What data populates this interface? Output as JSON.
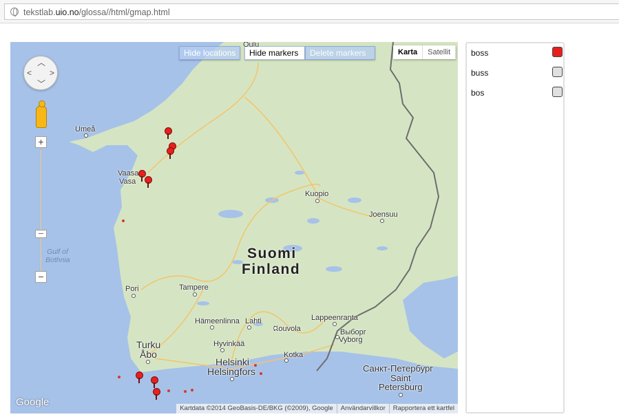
{
  "browser": {
    "url_prefix": "tekstlab.",
    "url_domain": "uio.no",
    "url_path": "/glossa//html/gmap.html"
  },
  "map": {
    "buttons": {
      "hide_locations": "Hide locations",
      "hide_markers": "Hide markers",
      "delete_markers": "Delete markers"
    },
    "map_types": [
      "Karta",
      "Satellit"
    ],
    "selected_map_type": "Karta",
    "places": {
      "umea": "Umeå",
      "oulu": "Oulu",
      "vaasa": "Vaasa",
      "vasa": "Vasa",
      "kuopio": "Kuopio",
      "joensuu": "Joensuu",
      "gulf1": "Gulf of",
      "gulf2": "Bothnia",
      "suomi": "Suomi",
      "finland": "Finland",
      "pori": "Pori",
      "tampere": "Tampere",
      "hameenlinna": "Hämeenlinna",
      "lahti": "Lahti",
      "kouvola": "Kouvola",
      "lappeenranta": "Lappeenranta",
      "vyborg_ru": "Выборг",
      "vyborg": "Vyborg",
      "kotka": "Kotka",
      "hyvinkaa": "Hyvinkää",
      "turku": "Turku",
      "abo": "Åbo",
      "helsinki": "Helsinki",
      "helsingfors": "Helsingfors",
      "spb_ru": "Санкт-Петербург",
      "spb_saint": "Saint",
      "spb": "Petersburg"
    },
    "logo": "Google",
    "attribution": [
      "Kartdata ©2014 GeoBasis-DE/BKG (©2009), Google",
      "Användarvillkor",
      "Rapportera ett kartfel"
    ]
  },
  "legend": {
    "items": [
      {
        "label": "boss",
        "color": "#e8201d",
        "checked": true
      },
      {
        "label": "buss",
        "color": "#e0e0e0",
        "checked": false
      },
      {
        "label": "bos",
        "color": "#e0e0e0",
        "checked": false
      }
    ]
  },
  "colors": {
    "water": "#a7c2e8",
    "land": "#d5e5c3",
    "marker": "#e8201d"
  }
}
